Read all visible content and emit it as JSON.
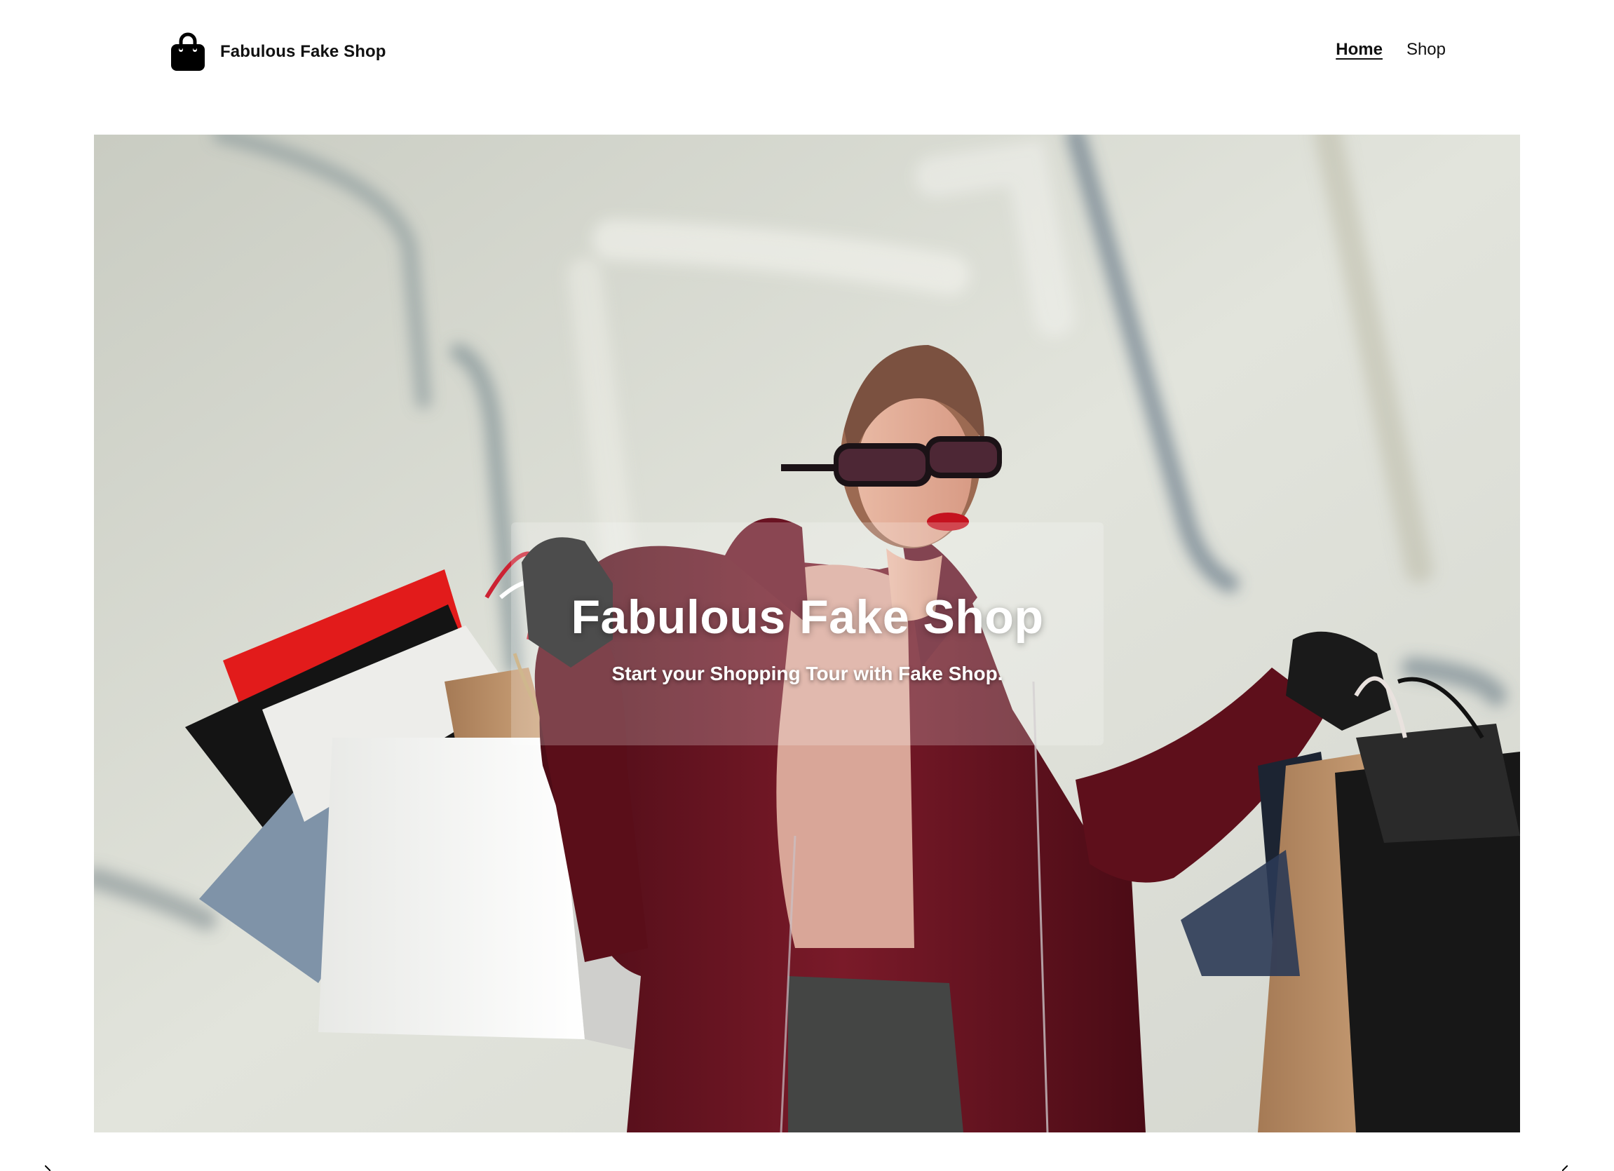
{
  "header": {
    "brand_name": "Fabulous Fake Shop",
    "logo_icon": "shopping-bag-icon",
    "nav": [
      {
        "label": "Home",
        "active": true
      },
      {
        "label": "Shop",
        "active": false
      }
    ]
  },
  "hero": {
    "image_alt": "woman in sunglasses and burgundy coat holding shopping bags",
    "title": "Fabulous Fake Shop",
    "subtitle": "Start your Shopping Tour with Fake Shop."
  },
  "colors": {
    "text": "#111111",
    "background": "#ffffff",
    "hero_text": "#ffffff",
    "coat": "#6e1624",
    "wall": "#dcded6"
  }
}
